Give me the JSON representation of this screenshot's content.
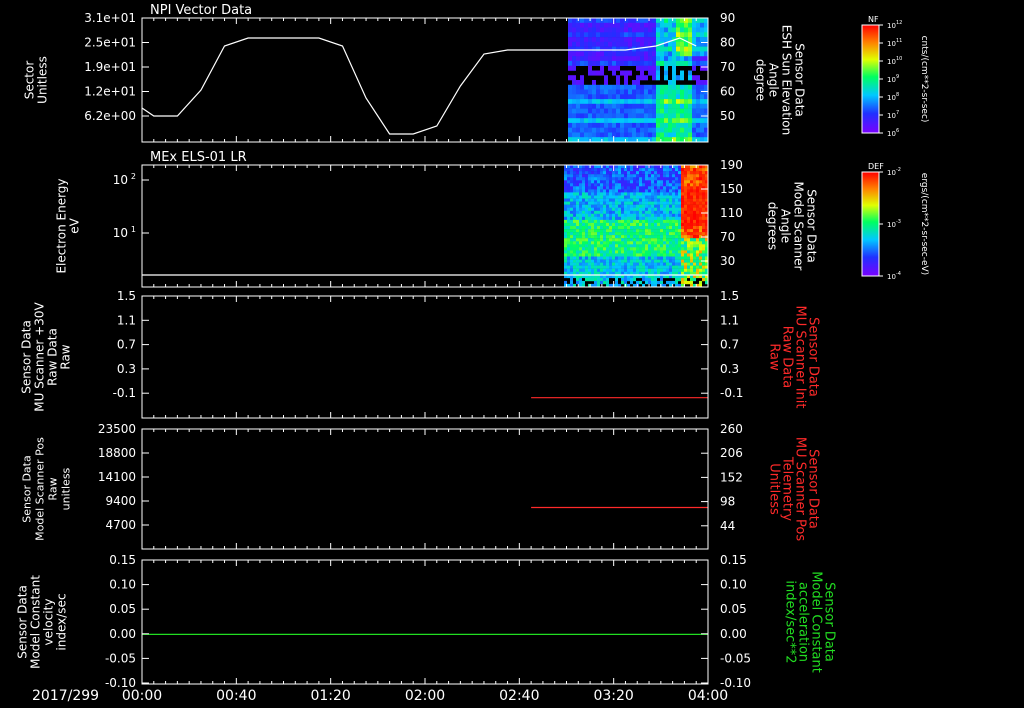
{
  "colors": {
    "white": "#ffffff",
    "red": "#ff2a2a",
    "green": "#22dd22",
    "bg": "#000000"
  },
  "time_axis": {
    "date": "2017/299",
    "ticks": [
      "00:00",
      "00:40",
      "01:20",
      "02:00",
      "02:40",
      "03:20",
      "04:00"
    ]
  },
  "chart_data": [
    {
      "type": "line",
      "panel": "panel1",
      "title": "NPI Vector Data",
      "left_axis": {
        "label_lines": [
          "Sector",
          "Unitless"
        ],
        "ticks": [
          "3.1e+01",
          "2.5e+01",
          "1.9e+01",
          "1.2e+01",
          "6.2e+00"
        ],
        "ylim": [
          0,
          31
        ]
      },
      "right_axis": {
        "label_lines": [
          "Sensor Data",
          "ESH Sun Elevation",
          "Angle",
          "degree"
        ],
        "ticks": [
          "90",
          "80",
          "70",
          "60",
          "50"
        ],
        "ylim": [
          40,
          90
        ]
      },
      "series": [
        {
          "axis": "left",
          "color": "#ffffff",
          "x": [
            "00:00",
            "00:05",
            "00:15",
            "00:25",
            "00:35",
            "00:45",
            "01:15",
            "01:25",
            "01:35",
            "01:45",
            "01:55",
            "02:05",
            "02:15",
            "02:25",
            "02:35",
            "02:50",
            "03:25",
            "03:38",
            "03:48",
            "03:55"
          ],
          "y": [
            8.5,
            6.5,
            6.5,
            13,
            24,
            26,
            26,
            24,
            11,
            2,
            2,
            4,
            14,
            22,
            23,
            23,
            23,
            24,
            26,
            24
          ]
        }
      ],
      "colorbar": {
        "label": "NF",
        "unit": "cnts/(cm**2-sr-sec)",
        "ticks": [
          "10^12",
          "10^11",
          "10^10",
          "10^9",
          "10^8",
          "10^7",
          "10^6"
        ]
      },
      "spectrogram_x": [
        "02:50",
        "04:00"
      ]
    },
    {
      "type": "heatmap",
      "panel": "panel2",
      "title": "MEx ELS-01 LR",
      "left_axis": {
        "label_lines": [
          "Electron Energy",
          "eV"
        ],
        "ticks": [
          "10^2",
          "10^1"
        ],
        "scale": "log"
      },
      "right_axis": {
        "label_lines": [
          "Sensor Data",
          "Model Scanner",
          "Angle",
          "degrees"
        ],
        "ticks": [
          "190",
          "150",
          "110",
          "70",
          "30"
        ]
      },
      "series": [
        {
          "axis": "right",
          "color": "#ffffff",
          "x": [
            "00:00",
            "04:00"
          ],
          "y": [
            10,
            10
          ]
        }
      ],
      "colorbar": {
        "label": "DEF",
        "unit": "ergs/(cm**2-sr-sec-eV)",
        "ticks": [
          "10^-2",
          "10^-3",
          "10^-4"
        ]
      },
      "spectrogram_x": [
        "02:50",
        "04:00"
      ]
    },
    {
      "type": "line",
      "panel": "panel3",
      "left_axis": {
        "label_lines": [
          "Sensor Data",
          "MU Scanner +30V",
          "Raw Data",
          "Raw"
        ],
        "ticks": [
          "1.5",
          "1.1",
          "0.7",
          "0.3",
          "-0.1"
        ],
        "ylim": [
          -0.3,
          1.5
        ]
      },
      "right_axis": {
        "label_lines": [
          "Sensor Data",
          "MU Scanner Init",
          "Raw Data",
          "Raw"
        ],
        "ticks": [
          "1.5",
          "1.1",
          "0.7",
          "0.3",
          "-0.1"
        ],
        "ylim": [
          -0.3,
          1.5
        ],
        "color": "#ff2a2a"
      },
      "series": [
        {
          "axis": "right",
          "color": "#ff2a2a",
          "x": [
            "02:45",
            "04:00"
          ],
          "y": [
            0,
            0
          ]
        }
      ]
    },
    {
      "type": "line",
      "panel": "panel4",
      "left_axis": {
        "label_lines": [
          "Sensor Data",
          "Model Scanner Pos",
          "Raw",
          "unitless"
        ],
        "ticks": [
          "23500",
          "18800",
          "14100",
          "9400",
          "4700"
        ],
        "ylim": [
          0,
          23500
        ]
      },
      "right_axis": {
        "label_lines": [
          "Sensor Data",
          "MU Scanner Pos",
          "Telemetry",
          "Unitless"
        ],
        "ticks": [
          "260",
          "206",
          "152",
          "98",
          "44"
        ],
        "ylim": [
          0,
          260
        ],
        "color": "#ff2a2a"
      },
      "series": [
        {
          "axis": "right",
          "color": "#ff2a2a",
          "x": [
            "02:45",
            "04:00"
          ],
          "y": [
            90,
            90
          ]
        }
      ]
    },
    {
      "type": "line",
      "panel": "panel5",
      "left_axis": {
        "label_lines": [
          "Sensor Data",
          "Model Constant",
          "velocity",
          "index/sec"
        ],
        "ticks": [
          "0.15",
          "0.10",
          "0.05",
          "0.00",
          "-0.05",
          "-0.10"
        ],
        "ylim": [
          -0.1,
          0.15
        ]
      },
      "right_axis": {
        "label_lines": [
          "Sensor Data",
          "Model Constant",
          "acceleration",
          "index/sec**2"
        ],
        "ticks": [
          "0.15",
          "0.10",
          "0.05",
          "0.00",
          "-0.05",
          "-0.10"
        ],
        "ylim": [
          -0.1,
          0.15
        ],
        "color": "#22dd22"
      },
      "series": [
        {
          "axis": "left",
          "color": "#22dd22",
          "x": [
            "00:00",
            "04:00"
          ],
          "y": [
            0,
            0
          ]
        }
      ]
    }
  ]
}
